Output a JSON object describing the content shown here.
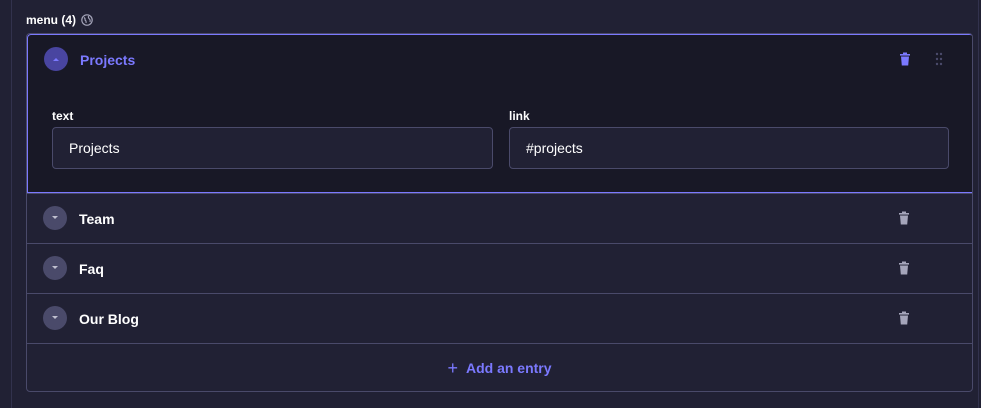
{
  "header": {
    "label": "menu (4)",
    "globe_icon": "globe-icon"
  },
  "entries": [
    {
      "label": "Projects",
      "expanded": true
    },
    {
      "label": "Team",
      "expanded": false
    },
    {
      "label": "Faq",
      "expanded": false
    },
    {
      "label": "Our Blog",
      "expanded": false
    }
  ],
  "open_entry": {
    "text_label": "text",
    "text_value": "Projects",
    "link_label": "link",
    "link_value": "#projects"
  },
  "add_entry": {
    "label": "Add an entry"
  },
  "colors": {
    "accent": "#7b79ff",
    "background": "#212134",
    "panel": "#181826",
    "border": "#4a4a6a"
  }
}
